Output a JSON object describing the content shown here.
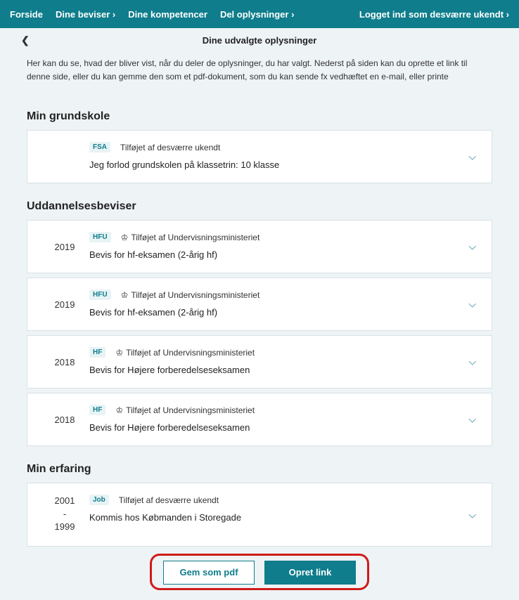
{
  "nav": {
    "items": [
      "Forside",
      "Dine beviser ›",
      "Dine kompetencer",
      "Del oplysninger ›"
    ],
    "right": "Logget ind som desværre ukendt ›"
  },
  "subheader": {
    "back_glyph": "❮",
    "title": "Dine udvalgte oplysninger"
  },
  "intro": "Her kan du se, hvad der bliver vist, når du deler de oplysninger, du har valgt. Nederst på siden kan du oprette et link til denne side, eller du kan gemme den som et pdf-dokument, som du kan sende fx vedhæftet en e-mail, eller printe",
  "sections": {
    "grundskole": {
      "title": "Min grundskole",
      "items": [
        {
          "tag": "FSA",
          "added": "Tilføjet af desværre ukendt",
          "desc": "Jeg forlod grundskolen på klassetrin: 10 klasse"
        }
      ]
    },
    "uddannelse": {
      "title": "Uddannelsesbeviser",
      "items": [
        {
          "year": "2019",
          "tag": "HFU",
          "crown": "♔",
          "added": "Tilføjet af Undervisningsministeriet",
          "desc": "Bevis for hf-eksamen (2-årig hf)"
        },
        {
          "year": "2019",
          "tag": "HFU",
          "crown": "♔",
          "added": "Tilføjet af Undervisningsministeriet",
          "desc": "Bevis for hf-eksamen (2-årig hf)"
        },
        {
          "year": "2018",
          "tag": "HF",
          "crown": "♔",
          "added": "Tilføjet af Undervisningsministeriet",
          "desc": "Bevis for Højere forberedelseseksamen"
        },
        {
          "year": "2018",
          "tag": "HF",
          "crown": "♔",
          "added": "Tilføjet af Undervisningsministeriet",
          "desc": "Bevis for Højere forberedelseseksamen"
        }
      ]
    },
    "erfaring": {
      "title": "Min erfaring",
      "items": [
        {
          "year_from": "2001",
          "year_sep": "-",
          "year_to": "1999",
          "tag": "Job",
          "added": "Tilføjet af desværre ukendt",
          "desc": "Kommis hos Købmanden i Storegade"
        }
      ]
    }
  },
  "footer": {
    "save_pdf": "Gem som pdf",
    "create_link": "Opret link"
  },
  "chevron": "⌵"
}
